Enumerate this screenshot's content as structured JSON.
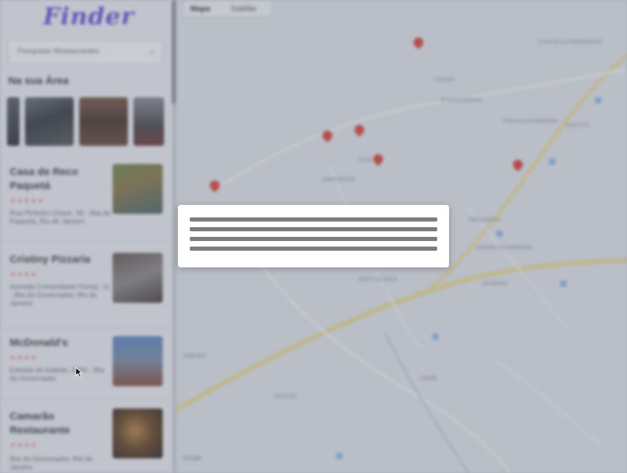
{
  "app": {
    "logo": "Finder"
  },
  "search": {
    "placeholder": "Pesquisar Restaurantes",
    "icon": "search-icon"
  },
  "sidebar": {
    "section_title": "Na sua Área",
    "restaurants": [
      {
        "name": "Casa de Reco Paquetá",
        "stars": "★★★★★",
        "address": "Rua Pinheiro Chave, 36 · Ilha de Paquetá, Rio de Janeiro"
      },
      {
        "name": "Cristiny Pizzaria",
        "stars": "★★★★",
        "address": "Avenida Comandante Ferraz, 11 · Ilha do Governador, Rio de Janeiro"
      },
      {
        "name": "McDonald's",
        "stars": "★★★★",
        "address": "Estrada do Galeão, 3000 · Ilha do Governador"
      },
      {
        "name": "Camarão Restaurante",
        "stars": "★★★★",
        "address": "Ilha do Governador, Rio de Janeiro"
      }
    ]
  },
  "map": {
    "tabs": [
      "Mapa",
      "Satélite"
    ],
    "labels": [
      "ILHA DO GOVERNADOR",
      "CACUIA",
      "PITANGUEIRAS",
      "PRAIA DA BANDEIRA",
      "COCOTÁ",
      "TAUÁ",
      "BANCÁRIOS",
      "FREGUESIA",
      "JARDIM GUANABARA",
      "PORTUGUESA",
      "MONERÓ",
      "RIBEIRA",
      "ZUMBI",
      "GALEÃO"
    ],
    "footer": "Google"
  },
  "modal": {
    "lines": 4
  },
  "colors": {
    "accent": "#6c55d6",
    "pin": "#d8493d",
    "overlay": "rgba(90,96,115,0.28)"
  }
}
